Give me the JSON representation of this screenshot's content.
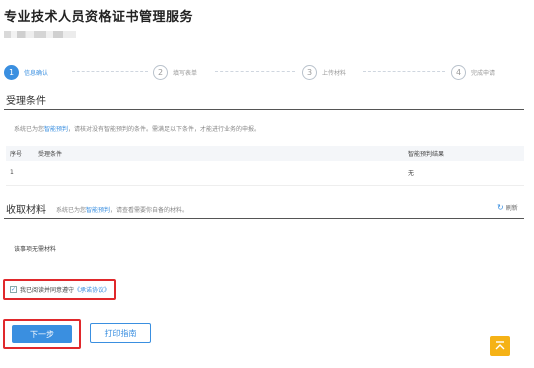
{
  "page": {
    "title": "专业技术人员资格证书管理服务"
  },
  "steps": [
    {
      "num": "1",
      "label": "信息确认"
    },
    {
      "num": "2",
      "label": "填写表单"
    },
    {
      "num": "3",
      "label": "上传材料"
    },
    {
      "num": "4",
      "label": "完成申请"
    }
  ],
  "conditions": {
    "title": "受理条件",
    "hint_prefix": "系统已为您",
    "hint_link": "智能预判",
    "hint_suffix": "，请核对没有智能预判的条件。需满足以下条件，才能进行业务的申报。",
    "headers": [
      "序号",
      "受理条件",
      "智能预判结果"
    ],
    "rows": [
      {
        "index": "1",
        "condition": "",
        "result": "无"
      }
    ]
  },
  "materials": {
    "title": "收取材料",
    "hint_prefix": "系统已为您",
    "hint_link": "智能预判",
    "hint_suffix": "，请查看需要你自备的材料。",
    "refresh_label": "刷新",
    "empty_text": "该事项无需材料"
  },
  "agreement": {
    "prefix": "我已阅读并同意遵守",
    "link": "《承诺协议》"
  },
  "buttons": {
    "next": "下一步",
    "print": "打印指南"
  },
  "colors": {
    "accent": "#3a8fe0",
    "highlight_border": "#e0282b",
    "back_to_top": "#f5b216"
  }
}
